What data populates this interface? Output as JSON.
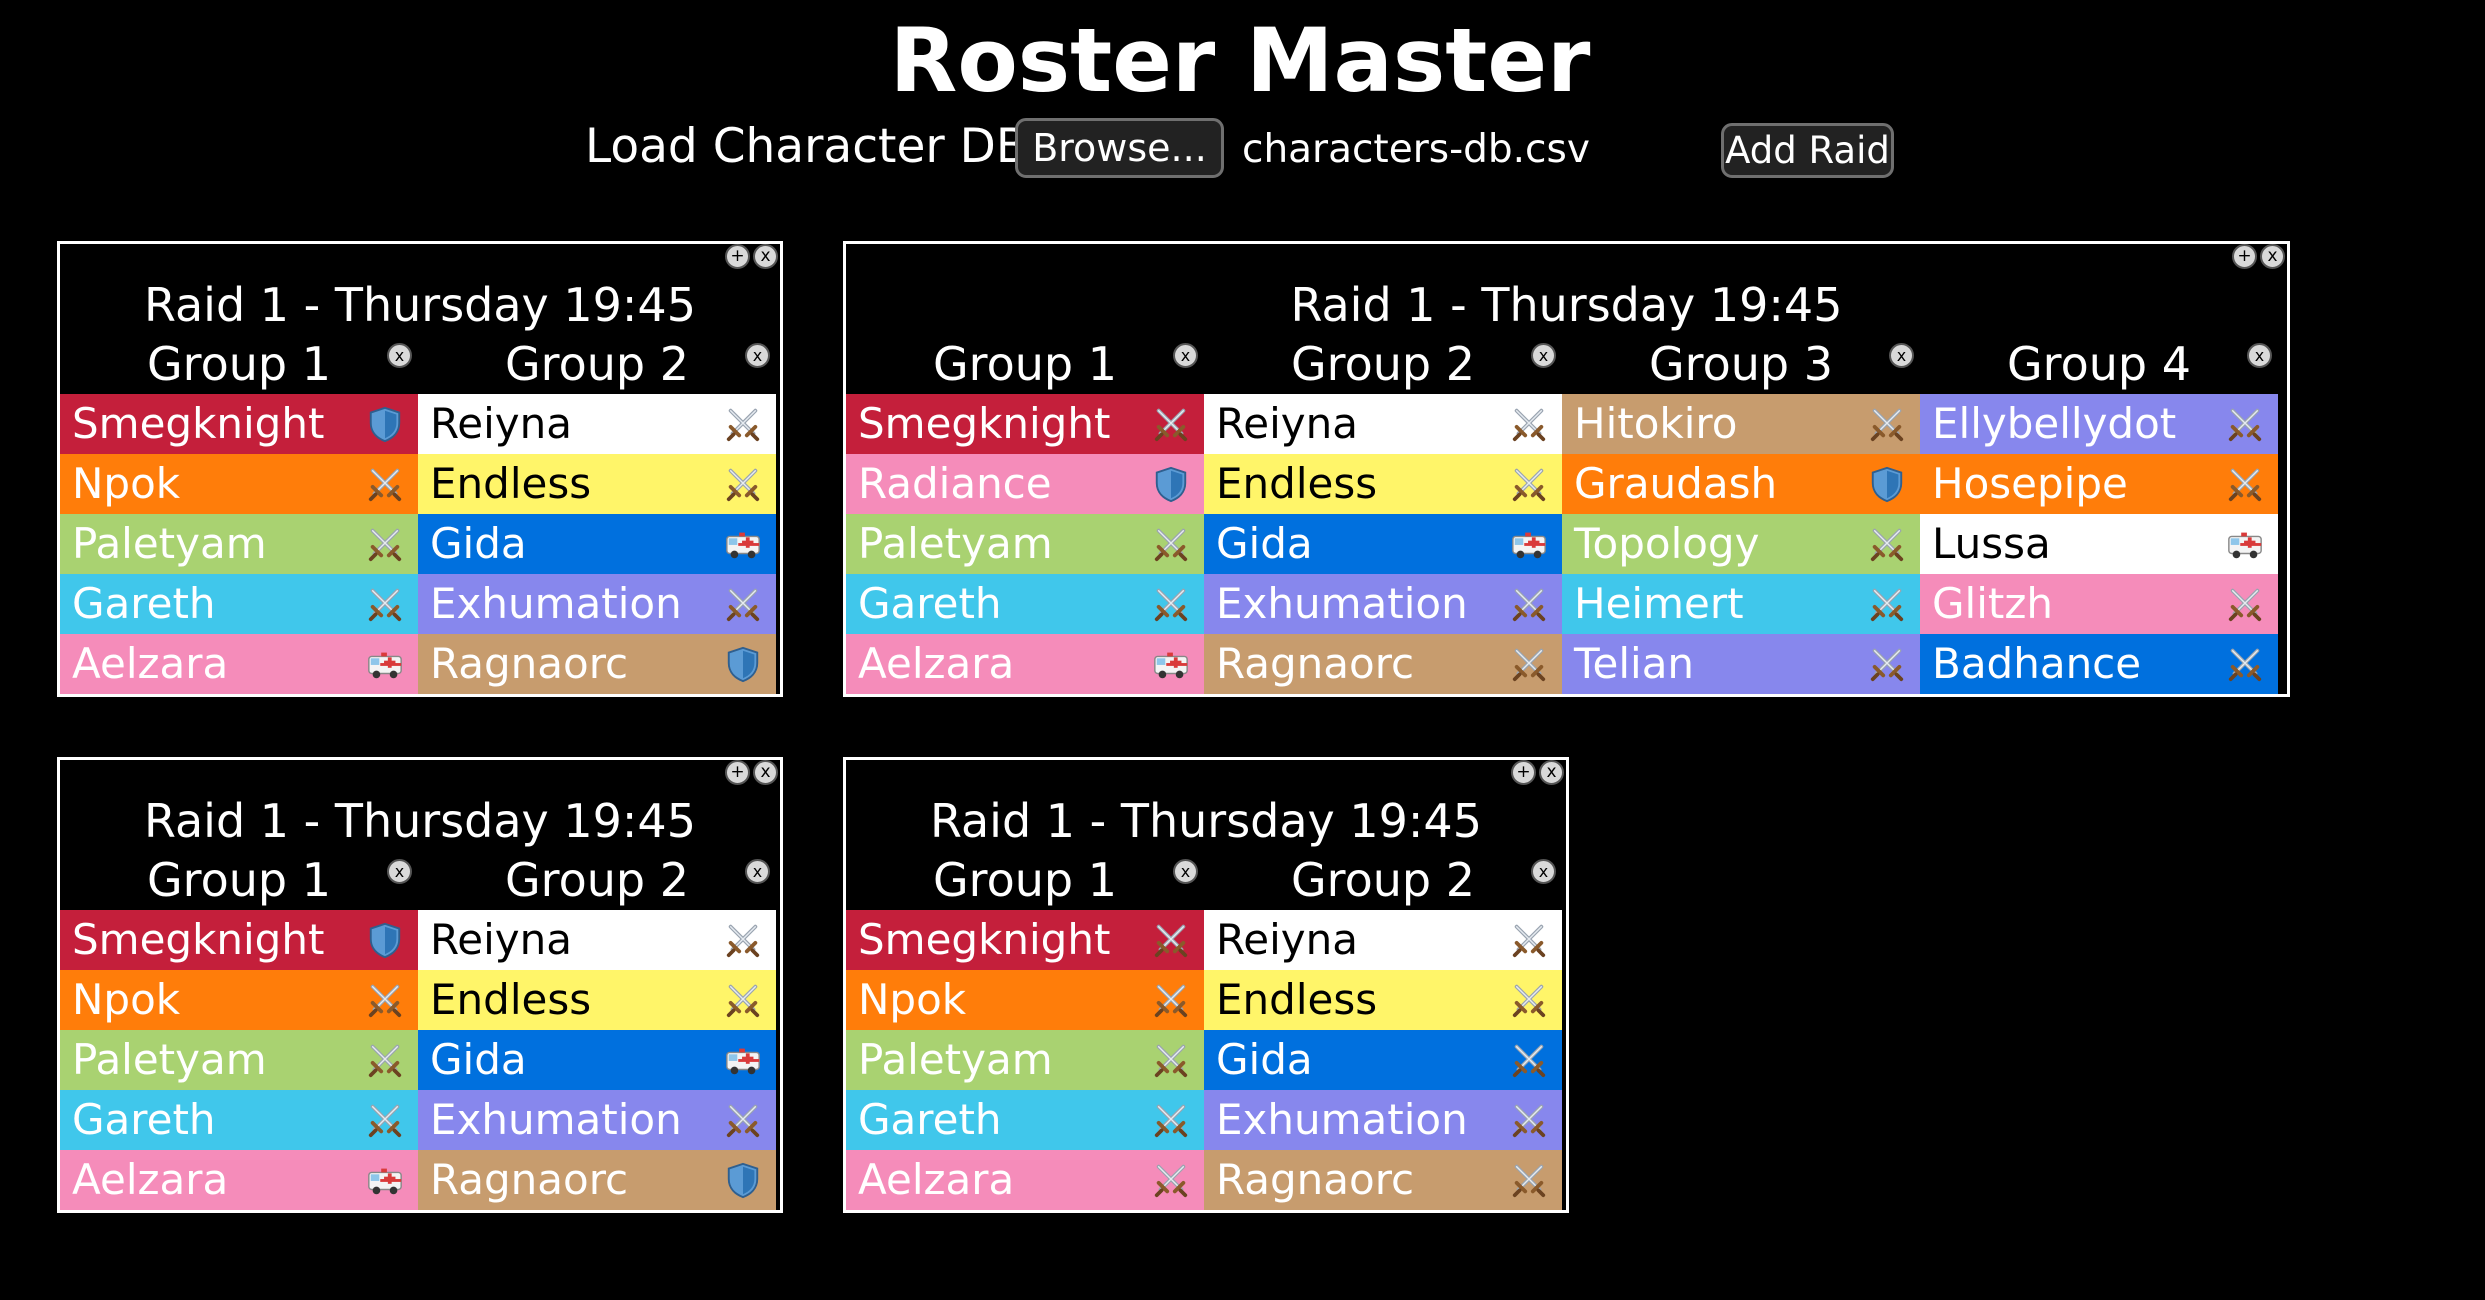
{
  "app": {
    "title": "Roster Master"
  },
  "toolbar": {
    "load_label": "Load Character DB",
    "browse_label": "Browse...",
    "file_name": "characters-db.csv",
    "add_raid_label": "Add Raid"
  },
  "panel_controls": {
    "add_symbol": "+",
    "close_symbol": "x"
  },
  "group_remove_symbol": "x",
  "colors": {
    "crimson": "#c41f3b",
    "orange": "#ff7d0a",
    "green": "#a9d271",
    "cyan": "#40c7eb",
    "pink": "#f58cba",
    "white": "#ffffff",
    "yellow": "#fff569",
    "blue": "#0070de",
    "purple": "#8787ed",
    "tan": "#c79c6e"
  },
  "raids": [
    {
      "title": "Raid 1 - Thursday 19:45",
      "groups": [
        {
          "name": "Group 1",
          "members": [
            {
              "name": "Smegknight",
              "class_color": "crimson",
              "role": "tank-shield-icon"
            },
            {
              "name": "Npok",
              "class_color": "orange",
              "role": "dps-swords-icon"
            },
            {
              "name": "Paletyam",
              "class_color": "green",
              "role": "dps-swords-icon"
            },
            {
              "name": "Gareth",
              "class_color": "cyan",
              "role": "dps-swords-icon"
            },
            {
              "name": "Aelzara",
              "class_color": "pink",
              "role": "healer-ambulance-icon"
            }
          ]
        },
        {
          "name": "Group 2",
          "members": [
            {
              "name": "Reiyna",
              "class_color": "white",
              "role": "dps-swords-icon"
            },
            {
              "name": "Endless",
              "class_color": "yellow",
              "role": "dps-swords-icon"
            },
            {
              "name": "Gida",
              "class_color": "blue",
              "role": "healer-ambulance-icon"
            },
            {
              "name": "Exhumation",
              "class_color": "purple",
              "role": "dps-swords-icon"
            },
            {
              "name": "Ragnaorc",
              "class_color": "tan",
              "role": "tank-shield-icon"
            }
          ]
        }
      ]
    },
    {
      "title": "Raid 1 - Thursday 19:45",
      "groups": [
        {
          "name": "Group 1",
          "members": [
            {
              "name": "Smegknight",
              "class_color": "crimson",
              "role": "dps-swords-icon"
            },
            {
              "name": "Radiance",
              "class_color": "pink",
              "role": "tank-shield-icon"
            },
            {
              "name": "Paletyam",
              "class_color": "green",
              "role": "dps-swords-icon"
            },
            {
              "name": "Gareth",
              "class_color": "cyan",
              "role": "dps-swords-icon"
            },
            {
              "name": "Aelzara",
              "class_color": "pink",
              "role": "healer-ambulance-icon"
            }
          ]
        },
        {
          "name": "Group 2",
          "members": [
            {
              "name": "Reiyna",
              "class_color": "white",
              "role": "dps-swords-icon"
            },
            {
              "name": "Endless",
              "class_color": "yellow",
              "role": "dps-swords-icon"
            },
            {
              "name": "Gida",
              "class_color": "blue",
              "role": "healer-ambulance-icon"
            },
            {
              "name": "Exhumation",
              "class_color": "purple",
              "role": "dps-swords-icon"
            },
            {
              "name": "Ragnaorc",
              "class_color": "tan",
              "role": "dps-swords-icon"
            }
          ]
        },
        {
          "name": "Group 3",
          "members": [
            {
              "name": "Hitokiro",
              "class_color": "tan",
              "role": "dps-swords-icon"
            },
            {
              "name": "Graudash",
              "class_color": "orange",
              "role": "tank-shield-icon"
            },
            {
              "name": "Topology",
              "class_color": "green",
              "role": "dps-swords-icon"
            },
            {
              "name": "Heimert",
              "class_color": "cyan",
              "role": "dps-swords-icon"
            },
            {
              "name": "Telian",
              "class_color": "purple",
              "role": "dps-swords-icon"
            }
          ]
        },
        {
          "name": "Group 4",
          "members": [
            {
              "name": "Ellybellydot",
              "class_color": "purple",
              "role": "dps-swords-icon"
            },
            {
              "name": "Hosepipe",
              "class_color": "orange",
              "role": "dps-swords-icon"
            },
            {
              "name": "Lussa",
              "class_color": "white",
              "role": "healer-ambulance-icon"
            },
            {
              "name": "Glitzh",
              "class_color": "pink",
              "role": "dps-swords-icon"
            },
            {
              "name": "Badhance",
              "class_color": "blue",
              "role": "dps-swords-icon"
            }
          ]
        }
      ]
    },
    {
      "title": "Raid 1 - Thursday 19:45",
      "groups": [
        {
          "name": "Group 1",
          "members": [
            {
              "name": "Smegknight",
              "class_color": "crimson",
              "role": "tank-shield-icon"
            },
            {
              "name": "Npok",
              "class_color": "orange",
              "role": "dps-swords-icon"
            },
            {
              "name": "Paletyam",
              "class_color": "green",
              "role": "dps-swords-icon"
            },
            {
              "name": "Gareth",
              "class_color": "cyan",
              "role": "dps-swords-icon"
            },
            {
              "name": "Aelzara",
              "class_color": "pink",
              "role": "healer-ambulance-icon"
            }
          ]
        },
        {
          "name": "Group 2",
          "members": [
            {
              "name": "Reiyna",
              "class_color": "white",
              "role": "dps-swords-icon"
            },
            {
              "name": "Endless",
              "class_color": "yellow",
              "role": "dps-swords-icon"
            },
            {
              "name": "Gida",
              "class_color": "blue",
              "role": "healer-ambulance-icon"
            },
            {
              "name": "Exhumation",
              "class_color": "purple",
              "role": "dps-swords-icon"
            },
            {
              "name": "Ragnaorc",
              "class_color": "tan",
              "role": "tank-shield-icon"
            }
          ]
        }
      ]
    },
    {
      "title": "Raid 1 - Thursday 19:45",
      "groups": [
        {
          "name": "Group 1",
          "members": [
            {
              "name": "Smegknight",
              "class_color": "crimson",
              "role": "dps-swords-icon"
            },
            {
              "name": "Npok",
              "class_color": "orange",
              "role": "dps-swords-icon"
            },
            {
              "name": "Paletyam",
              "class_color": "green",
              "role": "dps-swords-icon"
            },
            {
              "name": "Gareth",
              "class_color": "cyan",
              "role": "dps-swords-icon"
            },
            {
              "name": "Aelzara",
              "class_color": "pink",
              "role": "dps-swords-icon"
            }
          ]
        },
        {
          "name": "Group 2",
          "members": [
            {
              "name": "Reiyna",
              "class_color": "white",
              "role": "dps-swords-icon"
            },
            {
              "name": "Endless",
              "class_color": "yellow",
              "role": "dps-swords-icon"
            },
            {
              "name": "Gida",
              "class_color": "blue",
              "role": "dps-swords-icon"
            },
            {
              "name": "Exhumation",
              "class_color": "purple",
              "role": "dps-swords-icon"
            },
            {
              "name": "Ragnaorc",
              "class_color": "tan",
              "role": "dps-swords-icon"
            }
          ]
        }
      ]
    }
  ]
}
